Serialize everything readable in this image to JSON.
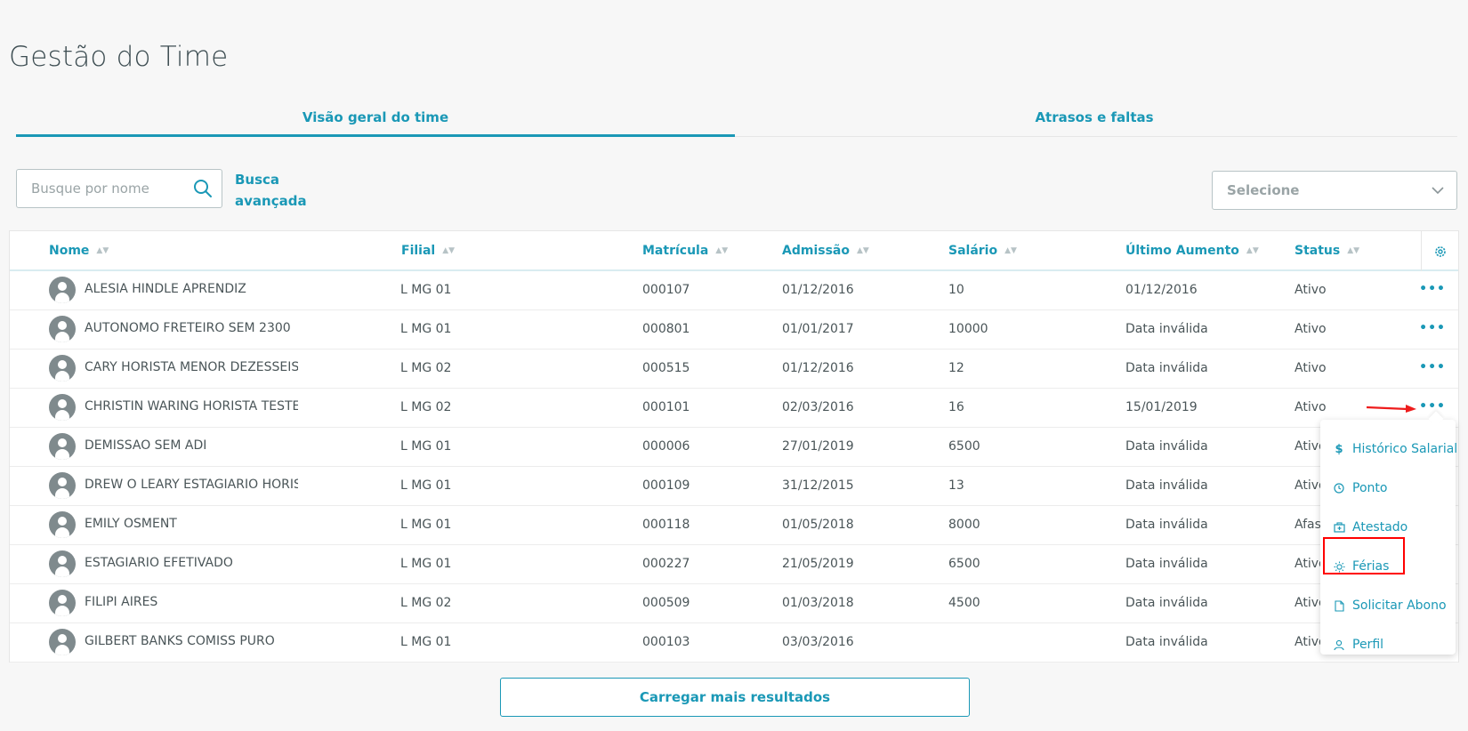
{
  "page": {
    "title": "Gestão do Time"
  },
  "tabs": [
    {
      "label": "Visão geral do time",
      "active": true
    },
    {
      "label": "Atrasos e faltas",
      "active": false
    }
  ],
  "search": {
    "placeholder": "Busque por nome",
    "value": "",
    "icon": "search-icon"
  },
  "advanced_search": {
    "line1": "Busca",
    "line2": "avançada"
  },
  "select": {
    "placeholder": "Selecione",
    "icon": "chevron-down-icon"
  },
  "table": {
    "columns": [
      "Nome",
      "Filial",
      "Matrícula",
      "Admissão",
      "Salário",
      "Último Aumento",
      "Status"
    ],
    "rows": [
      {
        "nome": "ALESIA HINDLE APRENDIZ",
        "filial": "L MG 01",
        "matricula": "000107",
        "admissao": "01/12/2016",
        "salario": "10",
        "ultimo": "01/12/2016",
        "status": "Ativo"
      },
      {
        "nome": "AUTONOMO FRETEIRO SEM 2300",
        "filial": "L MG 01",
        "matricula": "000801",
        "admissao": "01/01/2017",
        "salario": "10000",
        "ultimo": "Data inválida",
        "status": "Ativo"
      },
      {
        "nome": "CARY HORISTA MENOR DEZESSEIS",
        "filial": "L MG 02",
        "matricula": "000515",
        "admissao": "01/12/2016",
        "salario": "12",
        "ultimo": "Data inválida",
        "status": "Ativo"
      },
      {
        "nome": "CHRISTIN WARING HORISTA TESTE",
        "filial": "L MG 02",
        "matricula": "000101",
        "admissao": "02/03/2016",
        "salario": "16",
        "ultimo": "15/01/2019",
        "status": "Ativo"
      },
      {
        "nome": "DEMISSAO SEM ADI",
        "filial": "L MG 01",
        "matricula": "000006",
        "admissao": "27/01/2019",
        "salario": "6500",
        "ultimo": "Data inválida",
        "status": "Ativo"
      },
      {
        "nome": "DREW O LEARY ESTAGIARIO HORISTA",
        "filial": "L MG 01",
        "matricula": "000109",
        "admissao": "31/12/2015",
        "salario": "13",
        "ultimo": "Data inválida",
        "status": "Ativo"
      },
      {
        "nome": "EMILY OSMENT",
        "filial": "L MG 01",
        "matricula": "000118",
        "admissao": "01/05/2018",
        "salario": "8000",
        "ultimo": "Data inválida",
        "status": "Afast"
      },
      {
        "nome": "ESTAGIARIO EFETIVADO",
        "filial": "L MG 01",
        "matricula": "000227",
        "admissao": "21/05/2019",
        "salario": "6500",
        "ultimo": "Data inválida",
        "status": "Ativo"
      },
      {
        "nome": "FILIPI AIRES",
        "filial": "L MG 02",
        "matricula": "000509",
        "admissao": "01/03/2018",
        "salario": "4500",
        "ultimo": "Data inválida",
        "status": "Ativo"
      },
      {
        "nome": "GILBERT BANKS COMISS PURO",
        "filial": "L MG 01",
        "matricula": "000103",
        "admissao": "03/03/2016",
        "salario": "",
        "ultimo": "Data inválida",
        "status": "Ativo"
      }
    ],
    "row_action": "•••"
  },
  "actions_menu": {
    "items": [
      {
        "label": "Histórico Salarial",
        "icon": "dollar-icon"
      },
      {
        "label": "Ponto",
        "icon": "clock-icon"
      },
      {
        "label": "Atestado",
        "icon": "medical-kit-icon"
      },
      {
        "label": "Férias",
        "icon": "sun-icon"
      },
      {
        "label": "Solicitar Abono",
        "icon": "document-icon"
      },
      {
        "label": "Perfil",
        "icon": "user-icon"
      }
    ],
    "highlighted": "Férias"
  },
  "load_more": {
    "label": "Carregar mais resultados"
  },
  "colors": {
    "accent": "#1a98b6",
    "highlight": "#ff0000"
  }
}
